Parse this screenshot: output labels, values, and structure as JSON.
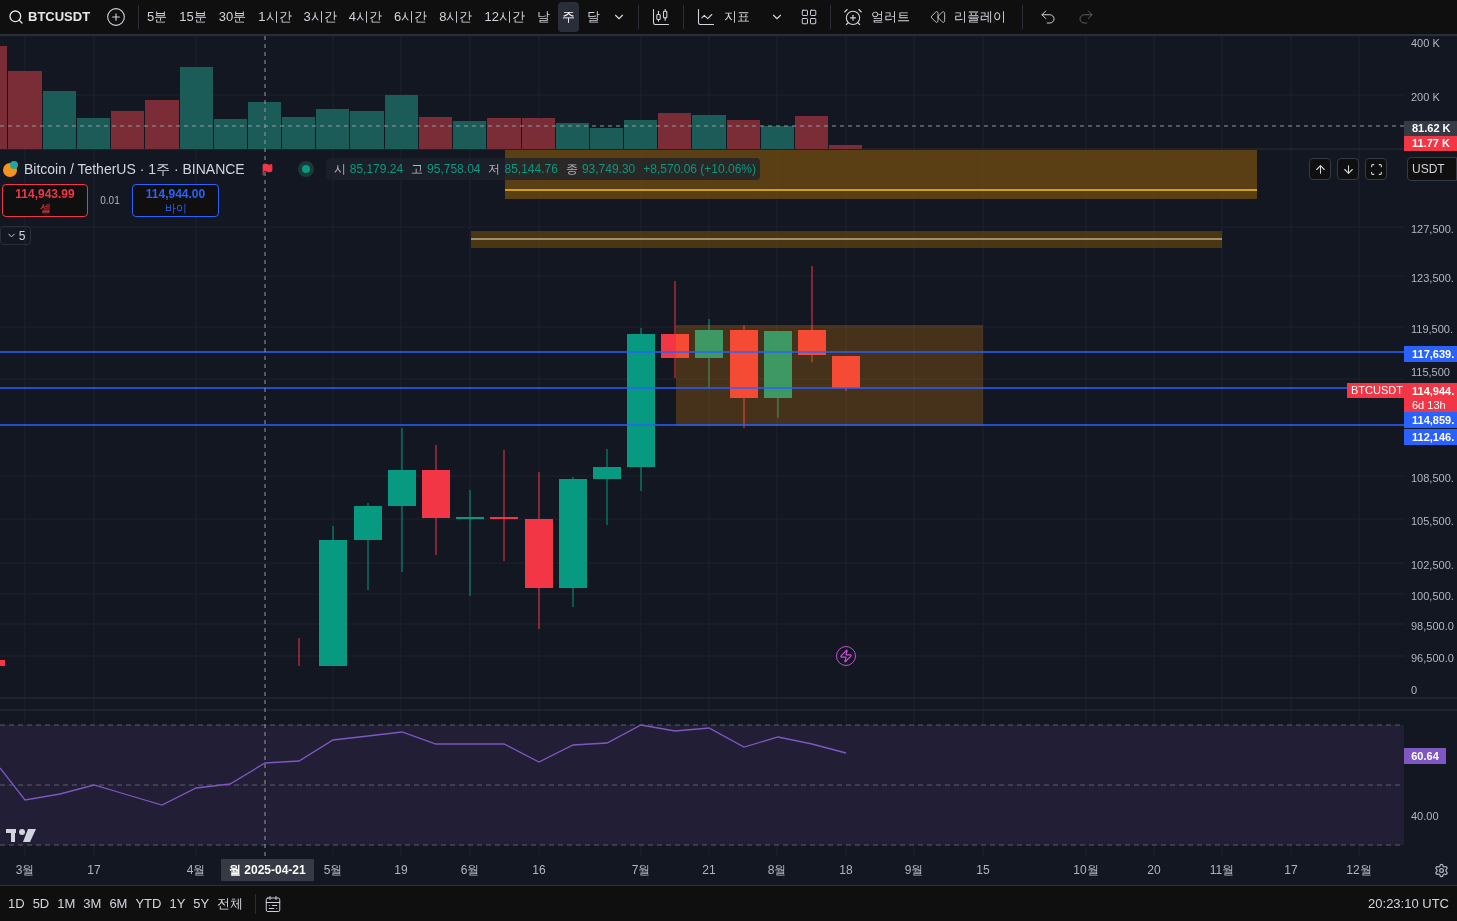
{
  "toolbar": {
    "symbol": "BTCUSDT",
    "intervals": [
      {
        "label": "5분",
        "selected": false
      },
      {
        "label": "15분",
        "selected": false
      },
      {
        "label": "30분",
        "selected": false
      },
      {
        "label": "1시간",
        "selected": false
      },
      {
        "label": "3시간",
        "selected": false
      },
      {
        "label": "4시간",
        "selected": false
      },
      {
        "label": "6시간",
        "selected": false
      },
      {
        "label": "8시간",
        "selected": false
      },
      {
        "label": "12시간",
        "selected": false
      },
      {
        "label": "날",
        "selected": false
      },
      {
        "label": "주",
        "selected": true
      },
      {
        "label": "달",
        "selected": false
      }
    ],
    "indicators": "지표",
    "alert": "얼러트",
    "replay": "리플레이"
  },
  "legend": {
    "title": "Bitcoin / TetherUS · 1주 · BINANCE",
    "ohlc": [
      {
        "label": "시",
        "value": "85,179.24"
      },
      {
        "label": "고",
        "value": "95,758.04"
      },
      {
        "label": "저",
        "value": "85,144.76"
      },
      {
        "label": "종",
        "value": "93,749.30"
      }
    ],
    "change": "+8,570.06 (+10.06%)",
    "sell": {
      "price": "114,943.99",
      "label": "셀"
    },
    "spread": "0.01",
    "buy": {
      "price": "114,944.00",
      "label": "바이"
    },
    "collapsed_count": "5"
  },
  "volume_axis": [
    "400 K",
    "200 K"
  ],
  "volume_labels": [
    {
      "value": "81.62 K",
      "color": "#363a45"
    },
    {
      "value": "11.77 K",
      "color": "#f23645"
    }
  ],
  "currency": "USDT",
  "price_axis": [
    "127,500.",
    "123,500.",
    "119,500.",
    "115,500",
    "108,500.",
    "105,500.",
    "102,500.",
    "100,500.",
    "98,500.0",
    "96,500.0",
    "0"
  ],
  "price_labels": [
    {
      "kind": "line",
      "value": "117,639."
    },
    {
      "kind": "last",
      "symbol": "BTCUSDT",
      "value": "114,944.",
      "countdown": "6d 13h"
    },
    {
      "kind": "line",
      "value": "114,859."
    },
    {
      "kind": "line",
      "value": "112,146."
    }
  ],
  "rsi": {
    "value": "60.64",
    "ticks": [
      "40.00"
    ]
  },
  "time_axis": {
    "labels": [
      "3월",
      "17",
      "4월",
      "5월",
      "19",
      "6월",
      "16",
      "7월",
      "21",
      "8월",
      "18",
      "9월",
      "15",
      "10월",
      "20",
      "11월",
      "17",
      "12월"
    ],
    "crosshair": "월 2025-04-21"
  },
  "ranges": [
    "1D",
    "5D",
    "1M",
    "3M",
    "6M",
    "YTD",
    "1Y",
    "5Y",
    "전체"
  ],
  "clock": "20:23:10 UTC"
}
